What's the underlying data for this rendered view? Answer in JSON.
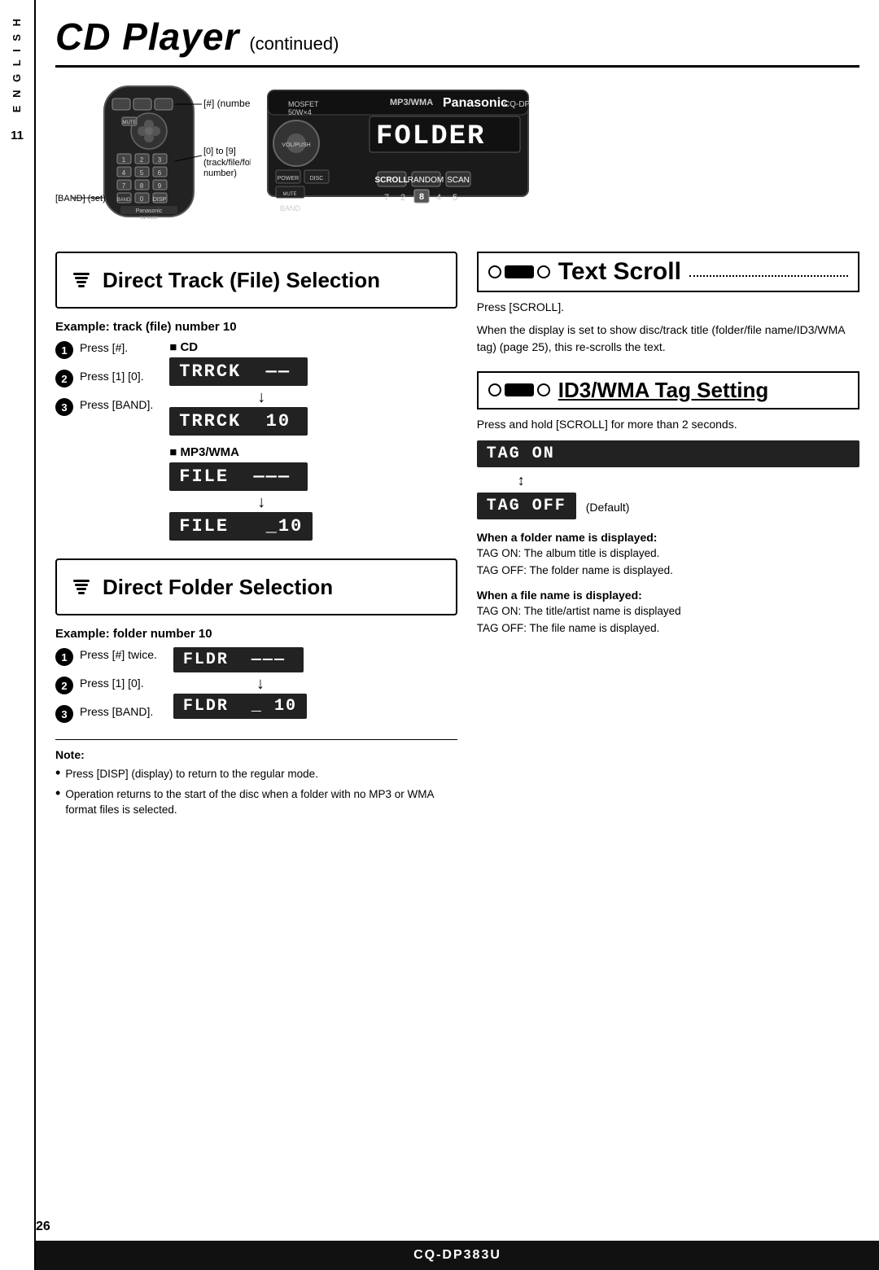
{
  "sidebar": {
    "letters": "E\nN\nG\nL\nI\nS\nH",
    "number": "11"
  },
  "header": {
    "title": "CD Player",
    "subtitle": "(continued)"
  },
  "remote": {
    "labels": {
      "hash_number": "[#] (number)",
      "zero_to_nine": "[0] to [9]",
      "track_file_folder": "(track/file/folder",
      "number": "number)",
      "band_set": "[BAND] (set)"
    }
  },
  "direct_track": {
    "title": "Direct Track (File) Selection",
    "example_label": "Example: track (file) number 10",
    "steps": [
      {
        "num": "1",
        "text": "Press [#]."
      },
      {
        "num": "2",
        "text": "Press [1] [0]."
      },
      {
        "num": "3",
        "text": "Press [BAND]."
      }
    ],
    "cd_label": "■ CD",
    "mp3_label": "■ MP3/WMA",
    "cd_display1": "TRRCK  ——",
    "cd_display2": "TRRCK  10",
    "mp3_display1": "FILE  ———",
    "mp3_display2": "FILE  _ 10"
  },
  "direct_folder": {
    "title": "Direct Folder Selection",
    "example_label": "Example: folder number 10",
    "steps": [
      {
        "num": "1",
        "text": "Press [#] twice."
      },
      {
        "num": "2",
        "text": "Press [1] [0]."
      },
      {
        "num": "3",
        "text": "Press [BAND]."
      }
    ],
    "display1": "FLDR  ———",
    "display2": "FLDR  _ 10"
  },
  "text_scroll": {
    "title": "Text Scroll",
    "press_text": "Press [SCROLL].",
    "description": "When the display is set to show disc/track title (folder/file name/ID3/WMA tag) (page 25), this re-scrolls the text."
  },
  "id3_tag": {
    "title": "ID3/WMA Tag Setting",
    "press_text": "Press and hold [SCROLL] for more than 2 seconds.",
    "tag_on": "TAG  ON",
    "tag_off": "TAG  OFF",
    "default_label": "(Default)",
    "when_folder": {
      "label": "When a folder name is displayed:",
      "on": "TAG ON:  The album title is displayed.",
      "off": "TAG OFF: The folder name is displayed."
    },
    "when_file": {
      "label": "When a file name is displayed:",
      "on": "TAG ON:  The title/artist name is displayed",
      "off": "TAG OFF: The file name is displayed."
    }
  },
  "note": {
    "label": "Note:",
    "items": [
      "Press [DISP] (display) to return to the regular mode.",
      "Operation returns to the start of the disc when a folder with no MP3 or WMA format files is selected."
    ]
  },
  "page_number": "26",
  "footer": {
    "model": "CQ-DP383U"
  },
  "device_display": {
    "top_line": "FOLDER",
    "brand": "Panasonic",
    "mp3wma": "MP3/WMA",
    "mosfet": "MOSFET 50W×4"
  }
}
